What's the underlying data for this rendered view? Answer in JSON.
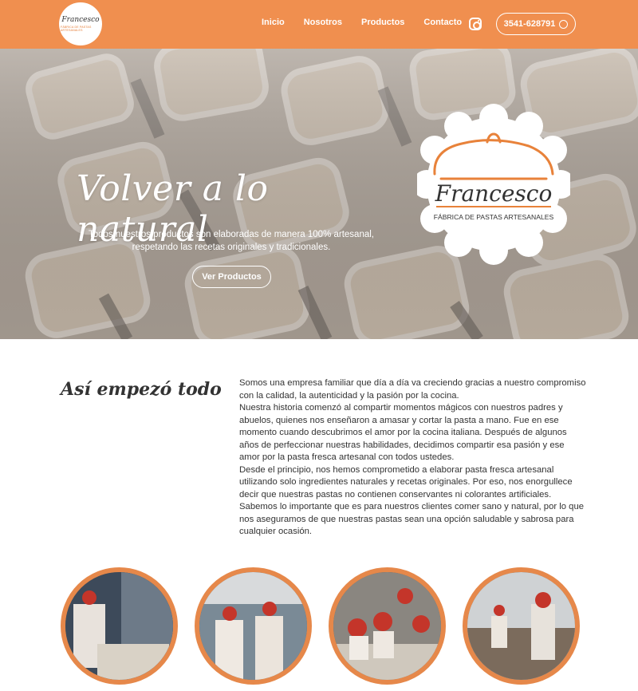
{
  "header": {
    "logo": {
      "script": "Francesco",
      "sub": "FÁBRICA DE PASTAS ARTESANALES"
    },
    "nav": [
      "Inicio",
      "Nosotros",
      "Productos",
      "Contacto"
    ],
    "instagram_icon": "instagram-icon",
    "phone": "3541-628791",
    "whatsapp_icon": "whatsapp-icon",
    "colors": {
      "primary": "#f08f4f"
    }
  },
  "hero": {
    "title": "Volver a lo natural",
    "subtitle_line1": "Todos nuestros productos son elaboradas de manera 100% artesanal,",
    "subtitle_line2": "respetando las recetas originales y tradicionales.",
    "button": "Ver Productos",
    "logo_script": "Francesco",
    "logo_sub": "FÁBRICA DE PASTAS ARTESANALES"
  },
  "about": {
    "title": "Así empezó todo",
    "paragraphs": [
      "Somos una empresa familiar que día a día va creciendo gracias a nuestro compromiso con la calidad, la autenticidad y la pasión por la cocina.",
      "Nuestra historia comenzó al compartir momentos mágicos con nuestros padres y abuelos, quienes nos enseñaron a amasar y cortar la pasta a mano. Fue en ese momento cuando descubrimos el amor por la cocina italiana. Después de algunos años de perfeccionar nuestras habilidades, decidimos compartir esa pasión y ese amor por la pasta fresca artesanal con todos ustedes.",
      "Desde el principio, nos hemos comprometido a elaborar pasta fresca artesanal utilizando solo ingredientes naturales y recetas originales. Por eso, nos enorgullece decir que nuestras pastas no contienen conservantes ni colorantes artificiales. Sabemos lo importante que es para nuestros clientes comer sano y natural, por lo que nos aseguramos de que nuestras pastas sean una opción saludable y sabrosa para cualquier ocasión."
    ]
  },
  "gallery": {
    "items": [
      "photo-1",
      "photo-2",
      "photo-3",
      "photo-4"
    ],
    "ring_color": "#e6884a"
  }
}
